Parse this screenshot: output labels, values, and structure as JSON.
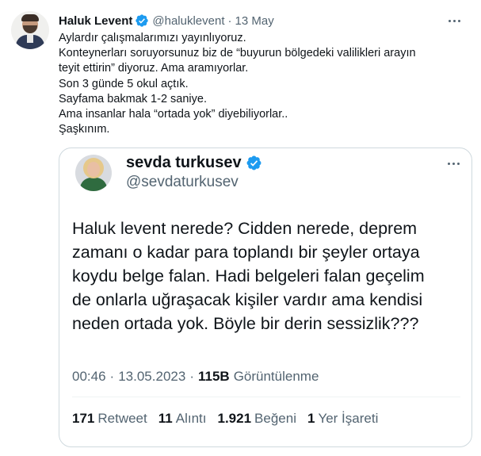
{
  "author": {
    "name": "Haluk Levent",
    "handle": "@haluklevent",
    "separator": "·",
    "date": "13 May"
  },
  "tweet_lines": [
    "Aylardır çalışmalarımızı yayınlıyoruz.",
    "Konteynerları soruyorsunuz biz de “buyurun bölgedeki valilikleri arayın",
    "teyit ettirin” diyoruz. Ama aramıyorlar.",
    "Son 3 günde 5 okul açtık.",
    "Sayfama bakmak 1-2 saniye.",
    "Ama insanlar hala “ortada yok” diyebiliyorlar..",
    "Şaşkınım."
  ],
  "quoted": {
    "name": "sevda turkusev",
    "handle": "@sevdaturkusev",
    "text_lines": [
      "Haluk levent nerede? Cidden nerede, deprem",
      "zamanı o kadar para toplandı bir şeyler ortaya",
      "koydu belge falan. Hadi belgeleri falan geçelim",
      "de onlarla uğraşacak kişiler vardır ama kendisi",
      "neden ortada yok. Böyle bir derin sessizlik???"
    ],
    "time": "00:46",
    "date": "13.05.2023",
    "separator": "·",
    "views_count": "115B",
    "views_label": "Görüntülenme",
    "stats": {
      "retweets_count": "171",
      "retweets_label": "Retweet",
      "quotes_count": "11",
      "quotes_label": "Alıntı",
      "likes_count": "1.921",
      "likes_label": "Beğeni",
      "bookmarks_count": "1",
      "bookmarks_label": "Yer İşareti"
    }
  },
  "colors": {
    "verified_blue": "#1d9bf0",
    "secondary_text": "#536471",
    "primary_text": "#0f1419",
    "border": "#cfd9de"
  },
  "icons": [
    "verified-badge-icon",
    "more-options-icon"
  ]
}
